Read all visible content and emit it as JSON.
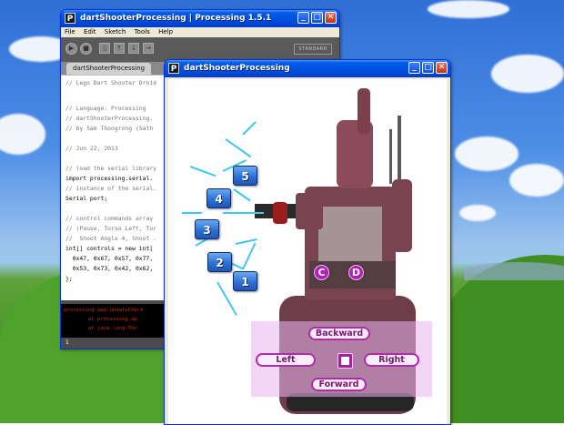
{
  "ide_window": {
    "title": "dartShooterProcessing | Processing 1.5.1",
    "menu": [
      "File",
      "Edit",
      "Sketch",
      "Tools",
      "Help"
    ],
    "mode": "STANDARD",
    "tab": "dartShooterProcessing",
    "code_lines": [
      "// Lego Dart Shooter Droid",
      "",
      "// Language: Processing",
      "// dartShooterProcessing.",
      "// by Sam Thongrong (Sath",
      "",
      "// Jun 22, 2013",
      "",
      "// load the serial library",
      "import processing.serial.",
      "// instance of the serial.",
      "Serial port;",
      "",
      "// control commands array",
      "// (Pause, Torso Left, Tor",
      "//  Shoot Angle 4, Shoot .",
      "int[] controls = new int[",
      "  0x47, 0x67, 0x57, 0x77,",
      "  0x53, 0x73, 0x42, 0x62,",
      "};"
    ],
    "console_lines": [
      "processing.app.UpdateCheck",
      "        at processing.ap",
      "        at java.lang.Thr"
    ],
    "line_number": "1"
  },
  "sketch_window": {
    "title": "dartShooterProcessing",
    "shoot_buttons": [
      "1",
      "2",
      "3",
      "4",
      "5"
    ],
    "turn_left": "C",
    "turn_right": "D",
    "drive": {
      "backward": "Backward",
      "forward": "Forward",
      "left": "Left",
      "right": "Right"
    }
  },
  "window_buttons": {
    "minimize": "_",
    "maximize": "□",
    "close": "✕"
  },
  "colors": {
    "titlebar": "#0054e3",
    "shoot_button": "#2e71d4",
    "ray": "#3ec7f0",
    "drive_pad": "#eab4ee",
    "drive_border": "#b02aa9",
    "turn_button": "#b21fb8"
  }
}
